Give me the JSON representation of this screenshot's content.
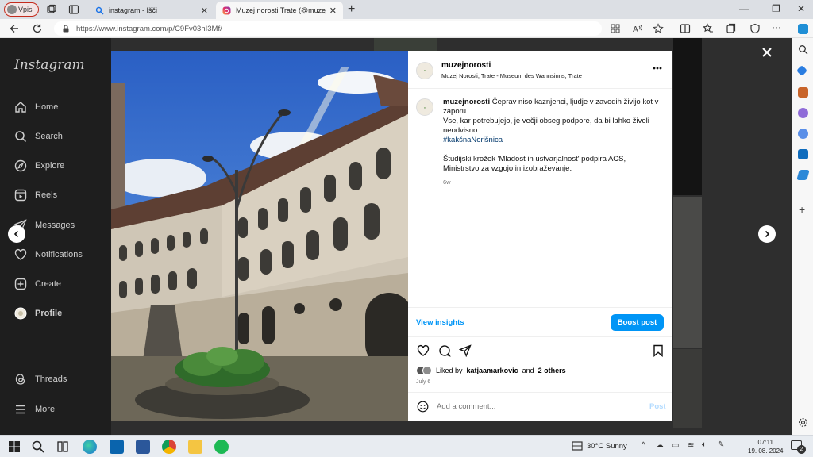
{
  "browser": {
    "profile_label": "Vpis",
    "tabs": [
      {
        "title": "instagram - Išči",
        "active": false
      },
      {
        "title": "Muzej norosti Trate (@muzejnorosti)",
        "active": true
      }
    ],
    "url": "https://www.instagram.com/p/C9Fv03hI3Mf/"
  },
  "instagram": {
    "logo": "Instagram",
    "nav": [
      {
        "label": "Home",
        "icon": "home-icon"
      },
      {
        "label": "Search",
        "icon": "search-icon"
      },
      {
        "label": "Explore",
        "icon": "explore-icon"
      },
      {
        "label": "Reels",
        "icon": "reels-icon"
      },
      {
        "label": "Messages",
        "icon": "messages-icon"
      },
      {
        "label": "Notifications",
        "icon": "heart-icon"
      },
      {
        "label": "Create",
        "icon": "plus-icon"
      },
      {
        "label": "Profile",
        "icon": "avatar"
      }
    ],
    "nav_bottom": [
      {
        "label": "Threads",
        "icon": "threads-icon"
      },
      {
        "label": "More",
        "icon": "menu-icon"
      }
    ]
  },
  "post": {
    "username": "muzejnorosti",
    "location": "Muzej Norosti, Trate - Museum des Wahnsinns, Trate",
    "caption_lines": [
      "Čeprav niso kaznjenci, ljudje v zavodih živijo kot v zaporu.",
      "Vse, kar potrebujejo, je večji obseg podpore, da bi lahko živeli neodvisno.",
      "#kakšnaNorišnica"
    ],
    "caption_first": "Čeprav niso kaznjenci, ljudje v zavodih živijo kot v",
    "caption_second": "zaporu.",
    "caption_third": "Vse, kar potrebujejo, je večji obseg podpore, da bi lahko živeli",
    "caption_fourth": "neodvisno.",
    "hashtag": "#kakšnaNorišnica",
    "note_line1": "Študijski krožek 'Mladost in ustvarjalnost' podpira ACS,",
    "note_line2": "Ministrstvo za vzgojo in izobraževanje.",
    "caption_age": "6w",
    "view_insights": "View insights",
    "boost_post": "Boost post",
    "liked_by_prefix": "Liked by",
    "liked_by_user": "katjaamarkovic",
    "liked_by_and": "and",
    "liked_by_others": "2 others",
    "date": "July 6",
    "comment_placeholder": "Add a comment...",
    "post_button": "Post"
  },
  "taskbar": {
    "weather": "30°C  Sunny",
    "time": "07:11",
    "date": "19. 08. 2024",
    "notifications": "2"
  },
  "colors": {
    "accent_blue": "#0095f6",
    "link_blue": "#00376b",
    "ig_bg": "#1e1e1e"
  }
}
